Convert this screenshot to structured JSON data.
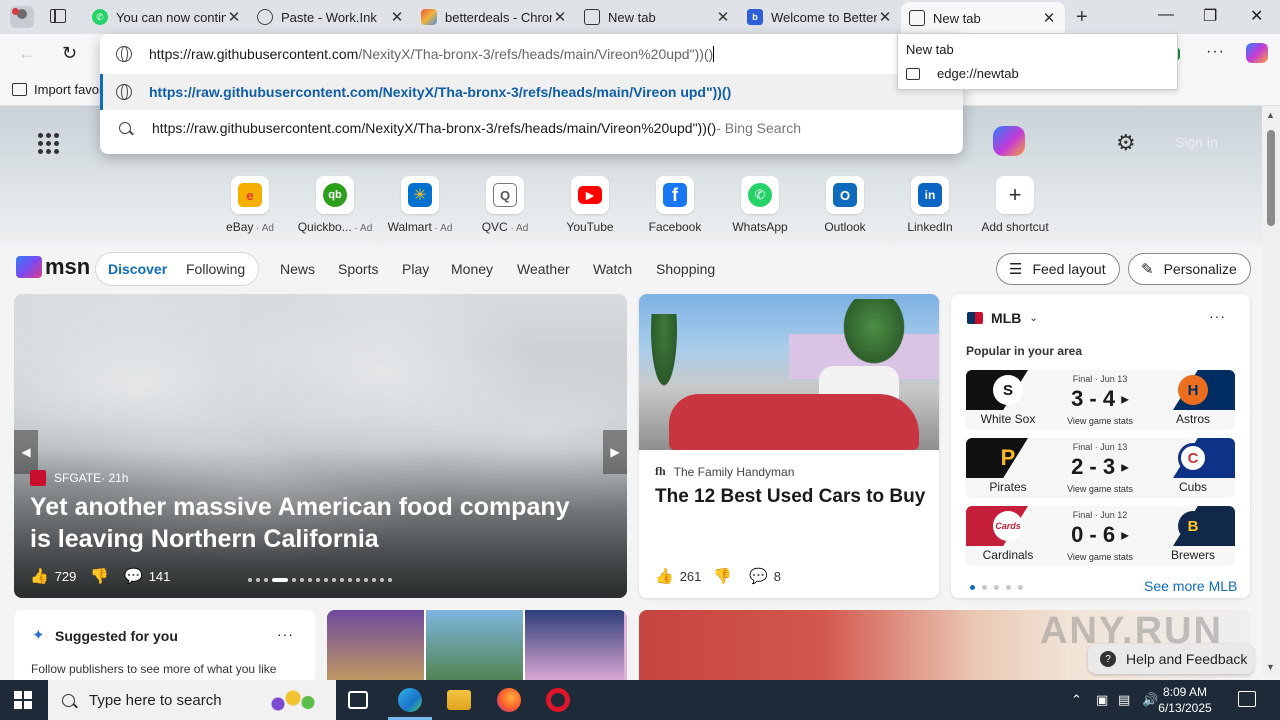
{
  "browser": {
    "tabs": [
      {
        "title": "You can now contin",
        "favicon": "whatsapp-icon",
        "color": "#25d366"
      },
      {
        "title": "Paste - Work.Ink",
        "favicon": "globe-icon",
        "color": "#5a5a5a"
      },
      {
        "title": "betterdeals - Chron",
        "favicon": "rainbow-icon",
        "color": "#e8593b"
      },
      {
        "title": "New tab",
        "favicon": "newtab-icon",
        "color": "#333333"
      },
      {
        "title": "Welcome to Better",
        "favicon": "betterdeals-icon",
        "color": "#2f5fd8"
      },
      {
        "title": "New tab",
        "favicon": "newtab-icon",
        "color": "#333333",
        "active": true
      }
    ],
    "address": {
      "host": "https://raw.githubusercontent.com",
      "path": "/NexityX/Tha-bronx-3/refs/heads/main/Vireon%20upd\"))()"
    },
    "suggestions": {
      "url": "https://raw.githubusercontent.com/NexityX/Tha-bronx-3/refs/heads/main/Vireon upd\"))()",
      "search": "https://raw.githubusercontent.com/NexityX/Tha-bronx-3/refs/heads/main/Vireon%20upd\"))()",
      "search_suffix": " - Bing Search"
    },
    "tooltip": {
      "title": "New tab",
      "url": "edge://newtab"
    },
    "favorites_bar": {
      "import_label": "Import favor"
    }
  },
  "newtab": {
    "signin_label": "Sign in",
    "shortcuts": [
      {
        "label": "eBay",
        "ad": " · Ad",
        "color": "#e53238",
        "glyph": "e"
      },
      {
        "label": "Quickbo...",
        "ad": " · Ad",
        "color": "#2ca01c",
        "glyph": "qb"
      },
      {
        "label": "Walmart",
        "ad": " · Ad",
        "color": "#0071ce",
        "glyph": "✳"
      },
      {
        "label": "QVC",
        "ad": " · Ad",
        "color": "#6b6b6b",
        "glyph": "Q"
      },
      {
        "label": "YouTube",
        "ad": "",
        "color": "#ff0000",
        "glyph": "▶"
      },
      {
        "label": "Facebook",
        "ad": "",
        "color": "#1877f2",
        "glyph": "f"
      },
      {
        "label": "WhatsApp",
        "ad": "",
        "color": "#25d366",
        "glyph": "✆"
      },
      {
        "label": "Outlook",
        "ad": "",
        "color": "#0f6cbd",
        "glyph": "O"
      },
      {
        "label": "LinkedIn",
        "ad": "",
        "color": "#0a66c2",
        "glyph": "in"
      },
      {
        "label": "Add shortcut",
        "ad": "",
        "color": "#ffffff",
        "glyph": "+"
      }
    ],
    "msn": {
      "logo": "msn",
      "tabs_pill": [
        "Discover",
        "Following"
      ],
      "tabs": [
        "News",
        "Sports",
        "Play",
        "Money",
        "Weather",
        "Watch",
        "Shopping"
      ],
      "feed_layout": "Feed layout",
      "personalize": "Personalize"
    },
    "hero": {
      "source": "SFGATE",
      "age": " · 21h",
      "headline": "Yet another massive American food company is leaving Northern California",
      "likes": "729",
      "comments": "141"
    },
    "card2": {
      "source": "The Family Handyman",
      "source_logo": "fh",
      "title": "The 12 Best Used Cars to Buy",
      "likes": "261",
      "comments": "8"
    },
    "mlb": {
      "league": "MLB",
      "subtitle": "Popular in your area",
      "games": [
        {
          "status": "Final · Jun 13",
          "score": "3 - 4",
          "stats": "View game stats",
          "home": "White Sox",
          "away": "Astros",
          "home_color": "#111111",
          "away_color": "#002d62",
          "home_glyph": "S",
          "away_glyph": "H"
        },
        {
          "status": "Final · Jun 13",
          "score": "2 - 3",
          "stats": "View game stats",
          "home": "Pirates",
          "away": "Cubs",
          "home_color": "#111111",
          "away_color": "#0e3386",
          "home_glyph": "P",
          "away_glyph": "C"
        },
        {
          "status": "Final · Jun 12",
          "score": "0 - 6",
          "stats": "View game stats",
          "home": "Cardinals",
          "away": "Brewers",
          "home_color": "#c41e3a",
          "away_color": "#12284b",
          "home_glyph": "Cards",
          "away_glyph": "B"
        }
      ],
      "see_more": "See more MLB"
    },
    "suggested": {
      "title": "Suggested for you",
      "desc": "Follow publishers to see more of what you like"
    },
    "help_feedback": "Help and Feedback",
    "watermark": "ANY.RUN"
  },
  "taskbar": {
    "search_placeholder": "Type here to search",
    "time": "8:09 AM",
    "date": "6/13/2025"
  }
}
